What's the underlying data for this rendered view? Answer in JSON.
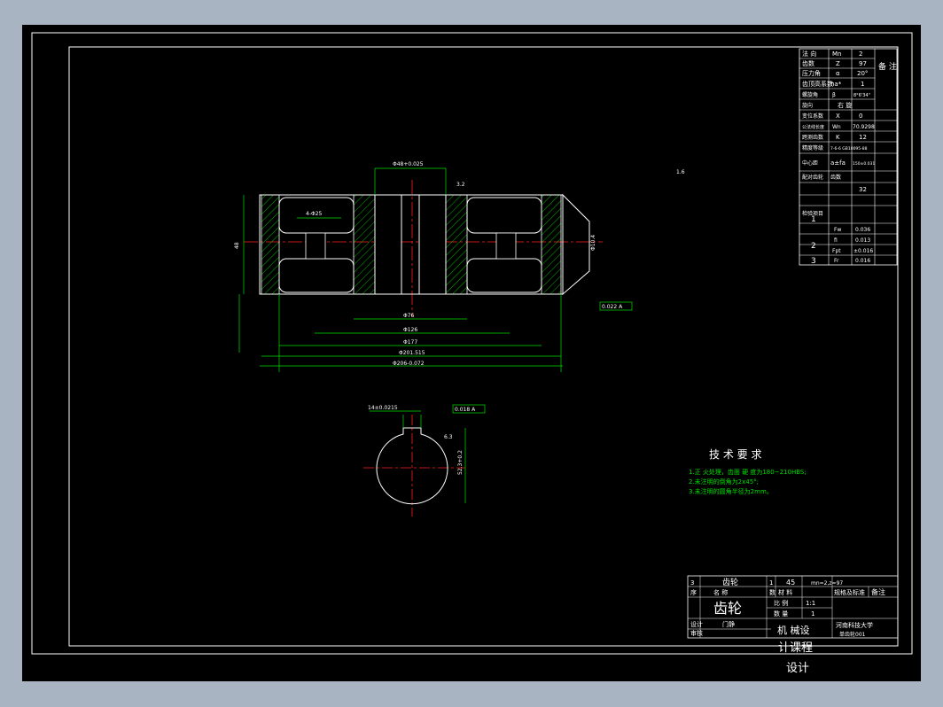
{
  "drawing": {
    "type": "gear drawing",
    "title_block": {
      "part_name": "齿轮",
      "material_label": "材 料",
      "designer_label": "设计",
      "designer_name": "门静",
      "checker_label": "审核",
      "school": "河南科技大学",
      "course_line1": "机 械设",
      "course_line2": "计课程",
      "course_line3": "设计",
      "scale_label": "比 例",
      "scale_value": "1:1",
      "qty_label": "数 量",
      "qty_value": "1",
      "row1": [
        "3",
        "齿轮",
        "1",
        "45",
        "mn=2,z=97"
      ],
      "header": [
        "序",
        "名 称",
        "数",
        "材 料",
        "规格及标准",
        "备注"
      ],
      "dwg_no": "单齿轮001"
    },
    "param_table": {
      "rows": [
        [
          "法 向",
          "Mn",
          "2"
        ],
        [
          "齿数",
          "Z",
          "97"
        ],
        [
          "压力角",
          "α",
          "20°"
        ],
        [
          "齿顶高系数",
          "ha*",
          "1"
        ],
        [
          "螺旋角",
          "β",
          "8°6'34\""
        ],
        [
          "旋向",
          "",
          "右 旋"
        ],
        [
          "变位系数",
          "X",
          "0"
        ],
        [
          "公法线长度",
          "Wn",
          "70.9298"
        ],
        [
          "跨测齿数",
          "K",
          "12"
        ],
        [
          "精度等级",
          "",
          "7-6-6 GB10095-88"
        ],
        [
          "中心距",
          "a±fa",
          "150±0.031"
        ],
        [
          "配对齿轮",
          "齿数",
          "32"
        ],
        [
          "检验项目",
          "Fw",
          "0.036"
        ],
        [
          "",
          "fi",
          "0.013"
        ],
        [
          "",
          "Fpt",
          "±0.016"
        ],
        [
          "",
          "Fr",
          "0.016"
        ]
      ],
      "remark_label": "备 注",
      "group_labels": [
        "1",
        "2",
        "3"
      ]
    },
    "tech_requirements": {
      "title": "技 术 要 求",
      "lines": [
        "1.正 火处理，齿面 硬 度为180~210HBS;",
        "2.未注明的倒角为2x45°;",
        "3.未注明的圆角半径为2mm。"
      ]
    },
    "dimensions": {
      "hub_bore": "Φ48+0.025",
      "d76": "Φ76",
      "d126": "Φ126",
      "d177": "Φ177",
      "d201": "Φ201.515",
      "d206": "Φ206-0.072",
      "width": "48",
      "keyway": "14±0.0215",
      "key_depth": "52.3+0.2",
      "chamfer_side": "4-Φ25",
      "runout": "0.022 A",
      "runout2": "0.018 A",
      "rough1": "3.2",
      "rough2": "6.3",
      "rough3": "1.6",
      "side_label": "Φ10.4"
    }
  }
}
